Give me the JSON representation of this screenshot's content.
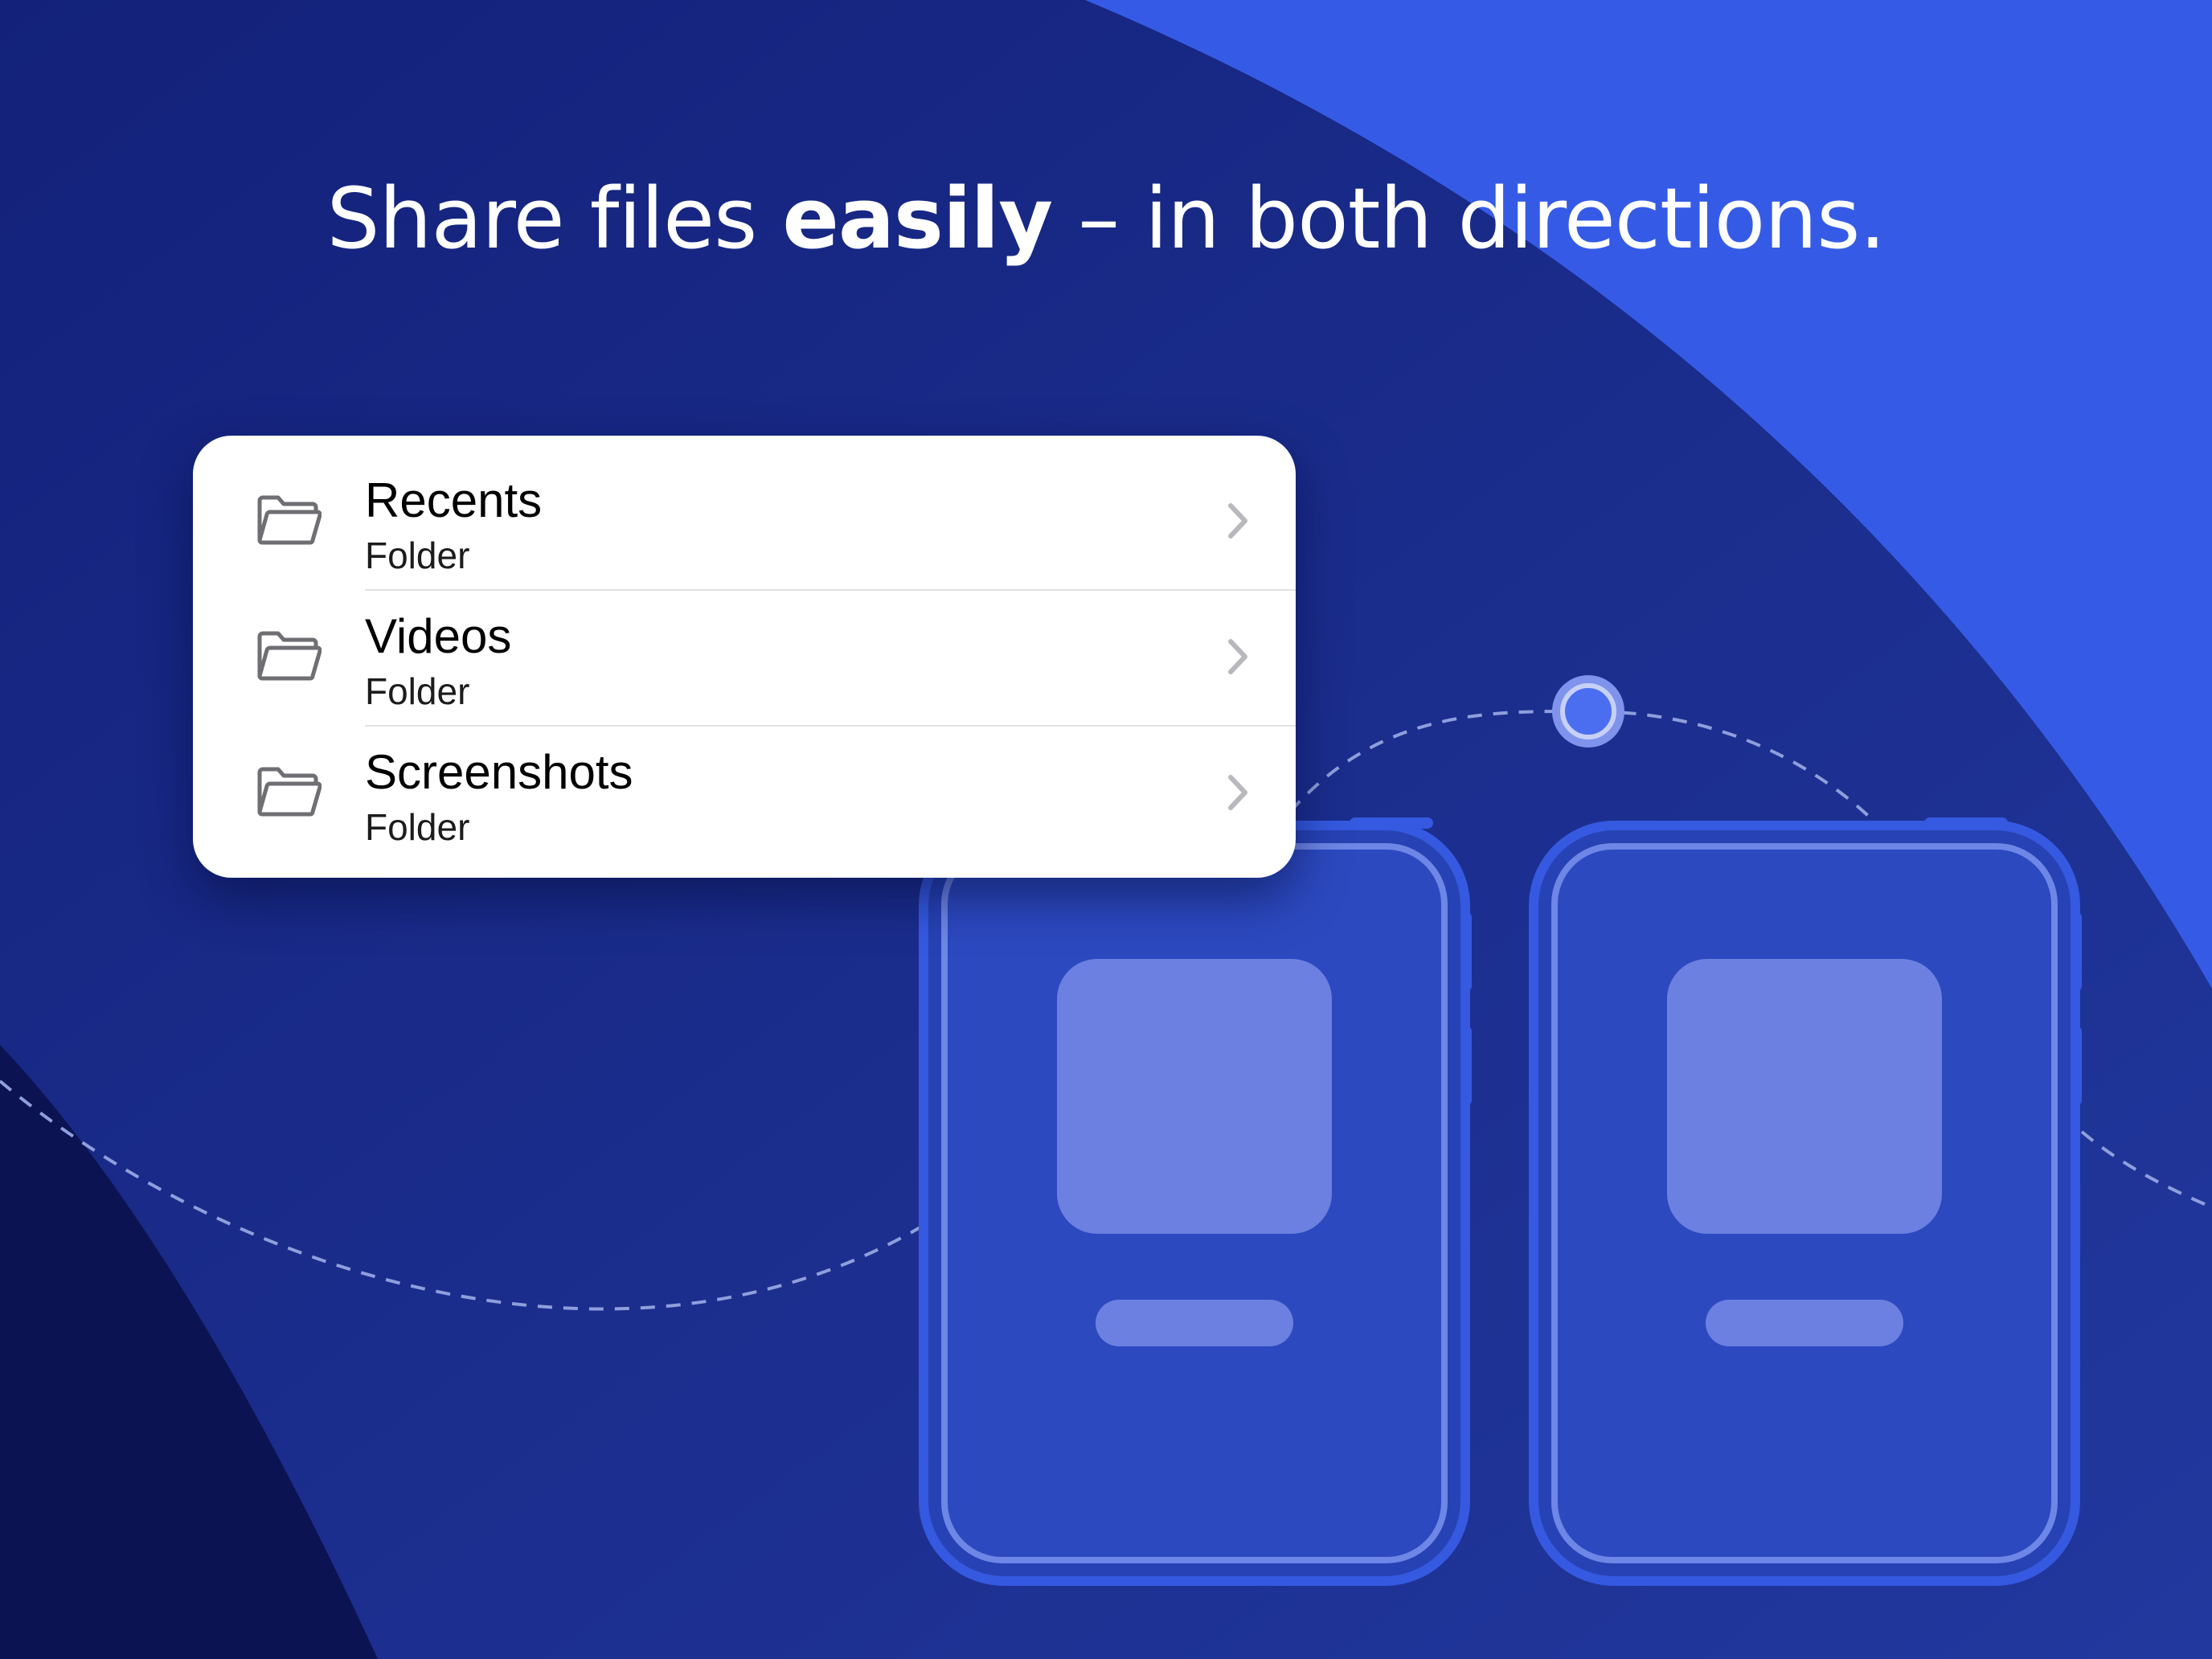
{
  "headline": {
    "before": "Share files ",
    "bold": "easily",
    "after": " – in both directions."
  },
  "file_list": {
    "items": [
      {
        "title": "Recents",
        "subtitle": "Folder",
        "icon": "folder-icon",
        "chevron": "chevron-right-icon"
      },
      {
        "title": "Videos",
        "subtitle": "Folder",
        "icon": "folder-icon",
        "chevron": "chevron-right-icon"
      },
      {
        "title": "Screenshots",
        "subtitle": "Folder",
        "icon": "folder-icon",
        "chevron": "chevron-right-icon"
      }
    ]
  },
  "colors": {
    "background_dark": "#1a2a8c",
    "background_light": "#355be6",
    "background_corner": "#0b1352",
    "device_outline": "#3559e0",
    "device_screen": "#2c49bf",
    "placeholder": "#6b80e0",
    "connection_dot": "#3b5cf0",
    "card": "#ffffff"
  }
}
